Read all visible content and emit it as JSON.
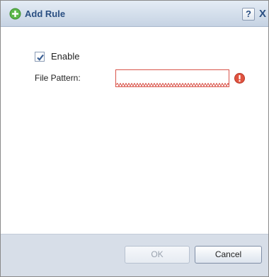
{
  "dialog": {
    "title": "Add Rule",
    "help_label": "?",
    "close_label": "X"
  },
  "form": {
    "enable": {
      "label": "Enable",
      "checked": true
    },
    "file_pattern": {
      "label": "File Pattern:",
      "value": "",
      "placeholder": ""
    }
  },
  "buttons": {
    "ok_label": "OK",
    "cancel_label": "Cancel"
  },
  "colors": {
    "title_text": "#2a4f82",
    "error": "#d9544a",
    "add_icon": "#5cb84a",
    "footer_bg": "#d7dee8"
  }
}
